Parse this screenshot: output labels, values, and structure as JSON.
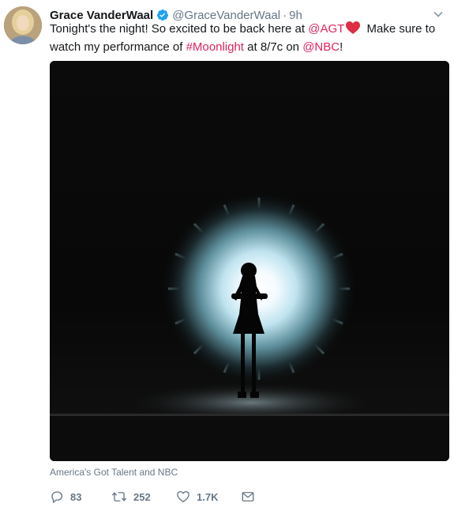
{
  "tweet": {
    "author": {
      "name": "Grace VanderWaal",
      "handle": "@GraceVanderWaal",
      "verified": true,
      "verified_color": "#1da1f2",
      "avatar_icon": "avatar-photo"
    },
    "separator": "·",
    "time": "9h",
    "text": {
      "part1": "Tonight's the night! So excited to be back here at ",
      "mention_agt": "@AGT",
      "heart_emoji": "red-heart-icon",
      "part2": " Make sure to watch my performance of ",
      "hashtag": "#Moonlight",
      "part3": " at 8/7c on ",
      "mention_nbc": "@NBC",
      "part4": "!"
    },
    "media": {
      "description_icon": "stage-silhouette-photo"
    },
    "media_credit": "America's Got Talent and NBC",
    "actions": {
      "replies": "83",
      "retweets": "252",
      "likes": "1.7K"
    }
  },
  "colors": {
    "link": "#e0245e",
    "secondary_text": "#657786",
    "primary_text": "#14171a",
    "heart": "#dd2e44"
  }
}
